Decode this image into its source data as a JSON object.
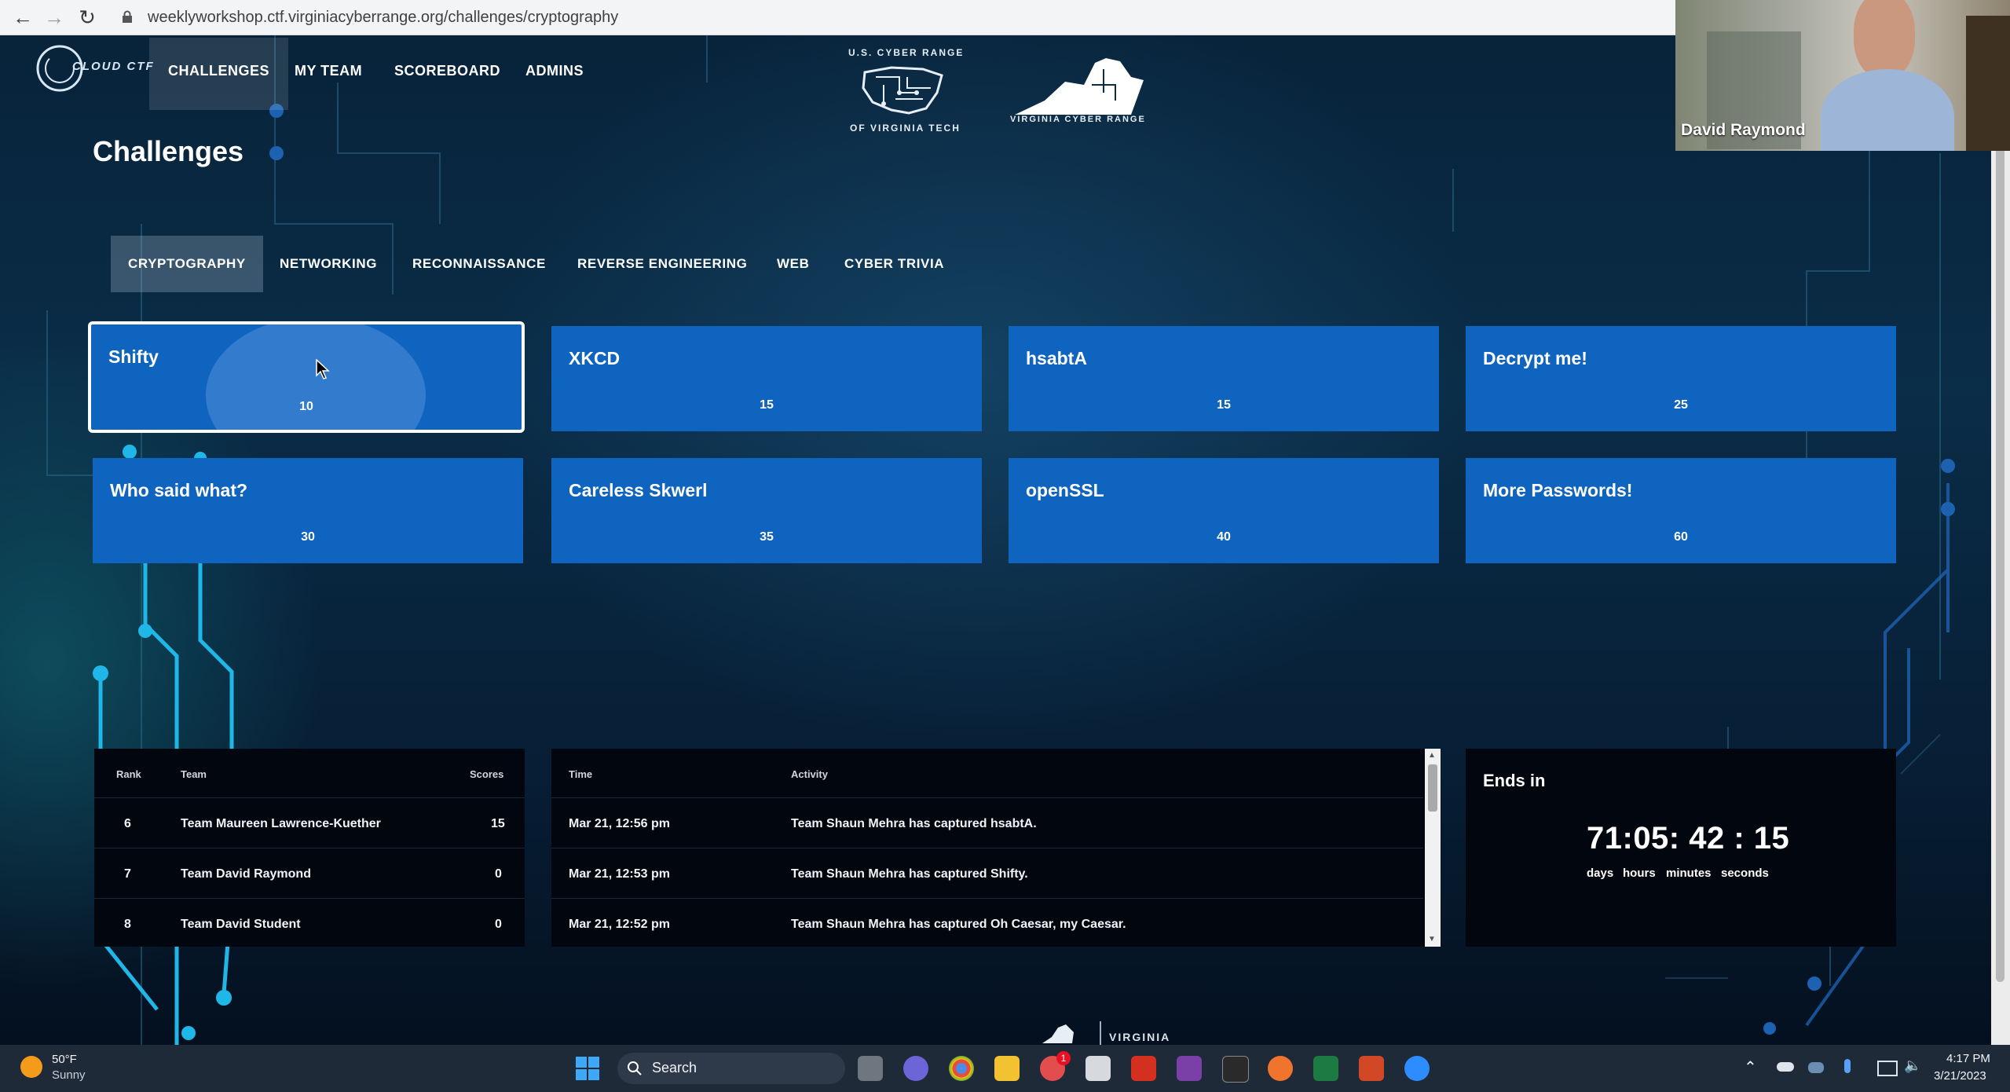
{
  "browser": {
    "url": "weeklyworkshop.ctf.virginiacyberrange.org/challenges/cryptography"
  },
  "header": {
    "logo_text": "CLOUD CTF",
    "nav": [
      "CHALLENGES",
      "MY TEAM",
      "SCOREBOARD",
      "ADMINS"
    ],
    "emblem1_top": "U.S. CYBER RANGE",
    "emblem1_bottom": "OF VIRGINIA TECH",
    "emblem2": "VIRGINIA CYBER RANGE"
  },
  "page_title": "Challenges",
  "categories": [
    "CRYPTOGRAPHY",
    "NETWORKING",
    "RECONNAISSANCE",
    "REVERSE ENGINEERING",
    "WEB",
    "CYBER TRIVIA"
  ],
  "challenges": [
    {
      "name": "Shifty",
      "points": "10"
    },
    {
      "name": "XKCD",
      "points": "15"
    },
    {
      "name": "hsabtA",
      "points": "15"
    },
    {
      "name": "Decrypt me!",
      "points": "25"
    },
    {
      "name": "Who said what?",
      "points": "30"
    },
    {
      "name": "Careless Skwerl",
      "points": "35"
    },
    {
      "name": "openSSL",
      "points": "40"
    },
    {
      "name": "More Passwords!",
      "points": "60"
    }
  ],
  "scoreboard": {
    "headers": {
      "rank": "Rank",
      "team": "Team",
      "scores": "Scores"
    },
    "rows": [
      {
        "rank": "6",
        "team": "Team Maureen Lawrence-Kuether",
        "score": "15"
      },
      {
        "rank": "7",
        "team": "Team David Raymond",
        "score": "0"
      },
      {
        "rank": "8",
        "team": "Team David Student",
        "score": "0"
      }
    ]
  },
  "activity": {
    "headers": {
      "time": "Time",
      "activity": "Activity"
    },
    "rows": [
      {
        "time": "Mar 21, 12:56 pm",
        "text": "Team Shaun Mehra has captured hsabtA."
      },
      {
        "time": "Mar 21, 12:53 pm",
        "text": "Team Shaun Mehra has captured Shifty."
      },
      {
        "time": "Mar 21, 12:52 pm",
        "text": "Team Shaun Mehra has captured Oh Caesar, my Caesar."
      }
    ]
  },
  "countdown": {
    "title": "Ends in",
    "value": "71:05: 42 : 15",
    "labels": [
      "days",
      "hours",
      "minutes",
      "seconds"
    ]
  },
  "webcam": {
    "name": "David Raymond"
  },
  "footer_partial": "VIRGINIA",
  "taskbar": {
    "weather_temp": "50°F",
    "weather_desc": "Sunny",
    "search": "Search",
    "time": "4:17 PM",
    "date": "3/21/2023",
    "badge": "1"
  },
  "colors": {
    "card": "#0f64c0",
    "circuit": "#1fb6e8",
    "panel": "#02060e"
  }
}
